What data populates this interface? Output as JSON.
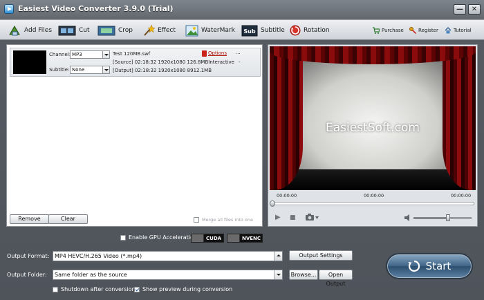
{
  "window": {
    "title": "Easiest Video Converter 3.9.0 (Trial)",
    "minimize": "—",
    "close": "✕"
  },
  "toolbar": {
    "add_files": "Add Files",
    "cut": "Cut",
    "crop": "Crop",
    "effect": "Effect",
    "watermark": "WaterMark",
    "subtitle": "Subtitle",
    "rotation": "Rotation",
    "purchase": "Purchase",
    "register": "Register",
    "tutorial": "Tutorial"
  },
  "file_item": {
    "channel_label": "Channel:",
    "channel_value": "MP3",
    "subtitle_label": "Subtitle:",
    "subtitle_value": "None",
    "filename": "Test 120MB.swf",
    "options": "Options",
    "ellipsis": "...",
    "source_line": "[Source]  02:18:32  1920x1080  126.8MBInteractive",
    "source_extra": "-",
    "output_line": "[Output]  02:18:32  1920x1080  8912.1MB"
  },
  "list_actions": {
    "remove": "Remove",
    "clear": "Clear",
    "merge": "Merge all files into one"
  },
  "preview": {
    "watermark": "EasiestSoft.com",
    "time_start": "00:00:00",
    "time_current": "00:00:00",
    "time_end": "00:00:00",
    "play_icon": "▶",
    "stop_icon": "■",
    "snapshot_icon": "camera-icon",
    "volume_level": 0.6
  },
  "gpu": {
    "label": "Enable GPU Acceleration",
    "cuda": "CUDA",
    "nvenc": "NVENC"
  },
  "output": {
    "format_label": "Output Format:",
    "format_value": "MP4 HEVC/H.265 Video (*.mp4)",
    "settings_button": "Output Settings",
    "folder_label": "Output Folder:",
    "folder_value": "Same folder as the source",
    "browse_button": "Browse...",
    "open_button": "Open Output",
    "shutdown_label": "Shutdown after conversion",
    "preview_label": "Show preview during conversion"
  },
  "start": {
    "label": "Start"
  },
  "colors": {
    "accent_red": "#b1120a",
    "start_blue": "#3f6486"
  }
}
